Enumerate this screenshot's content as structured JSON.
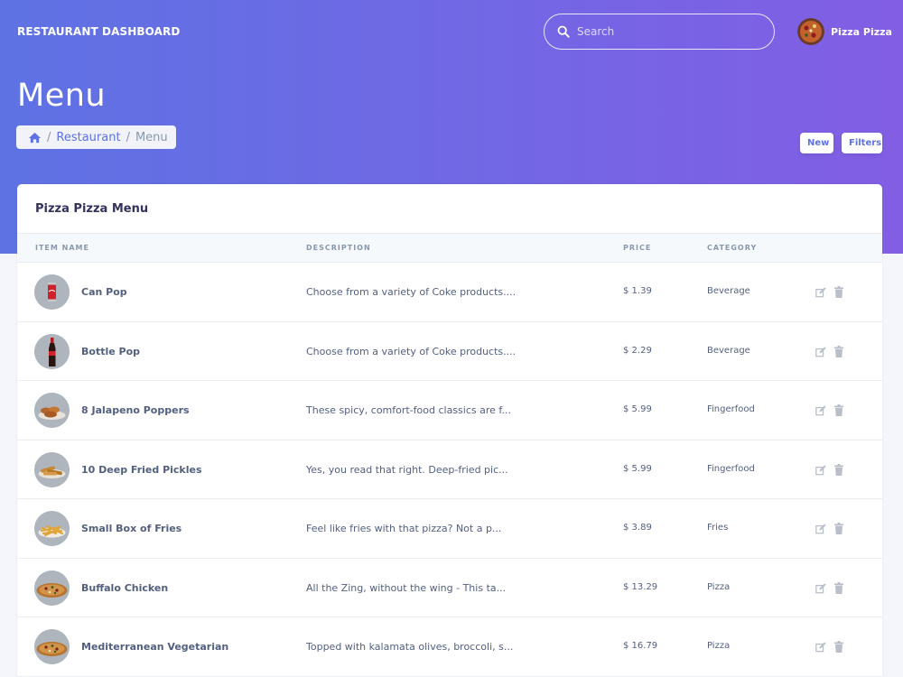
{
  "header": {
    "brand": "RESTAURANT DASHBOARD",
    "search_placeholder": "Search",
    "user_name": "Pizza Pizza"
  },
  "page": {
    "title": "Menu",
    "breadcrumb": [
      "Restaurant",
      "Menu"
    ],
    "buttons": {
      "new": "New",
      "filters": "Filters"
    }
  },
  "card": {
    "title": "Pizza Pizza Menu",
    "columns": [
      "ITEM NAME",
      "DESCRIPTION",
      "PRICE",
      "CATEGORY"
    ]
  },
  "items": [
    {
      "name": "Can Pop",
      "description": "Choose from a variety of Coke products....",
      "price": "$ 1.39",
      "category": "Beverage",
      "thumb": "can-icon"
    },
    {
      "name": "Bottle Pop",
      "description": "Choose from a variety of Coke products....",
      "price": "$ 2.29",
      "category": "Beverage",
      "thumb": "bottle-icon"
    },
    {
      "name": "8 Jalapeno Poppers",
      "description": "These spicy, comfort-food classics are f...",
      "price": "$ 5.99",
      "category": "Fingerfood",
      "thumb": "poppers-icon"
    },
    {
      "name": "10 Deep Fried Pickles",
      "description": "Yes, you read that right. Deep-fried pic...",
      "price": "$ 5.99",
      "category": "Fingerfood",
      "thumb": "pickles-icon"
    },
    {
      "name": "Small Box of Fries",
      "description": "Feel like fries with that pizza? Not a p...",
      "price": "$ 3.89",
      "category": "Fries",
      "thumb": "fries-icon"
    },
    {
      "name": "Buffalo Chicken",
      "description": "All the Zing, without the wing - This ta...",
      "price": "$ 13.29",
      "category": "Pizza",
      "thumb": "pizza-icon"
    },
    {
      "name": "Mediterranean Vegetarian",
      "description": "Topped with kalamata olives, broccoli, s...",
      "price": "$ 16.79",
      "category": "Pizza",
      "thumb": "pizza-icon"
    }
  ],
  "colors": {
    "gradient_start": "#5e72e4",
    "gradient_end": "#825ee4",
    "accent": "#5e72e4"
  }
}
